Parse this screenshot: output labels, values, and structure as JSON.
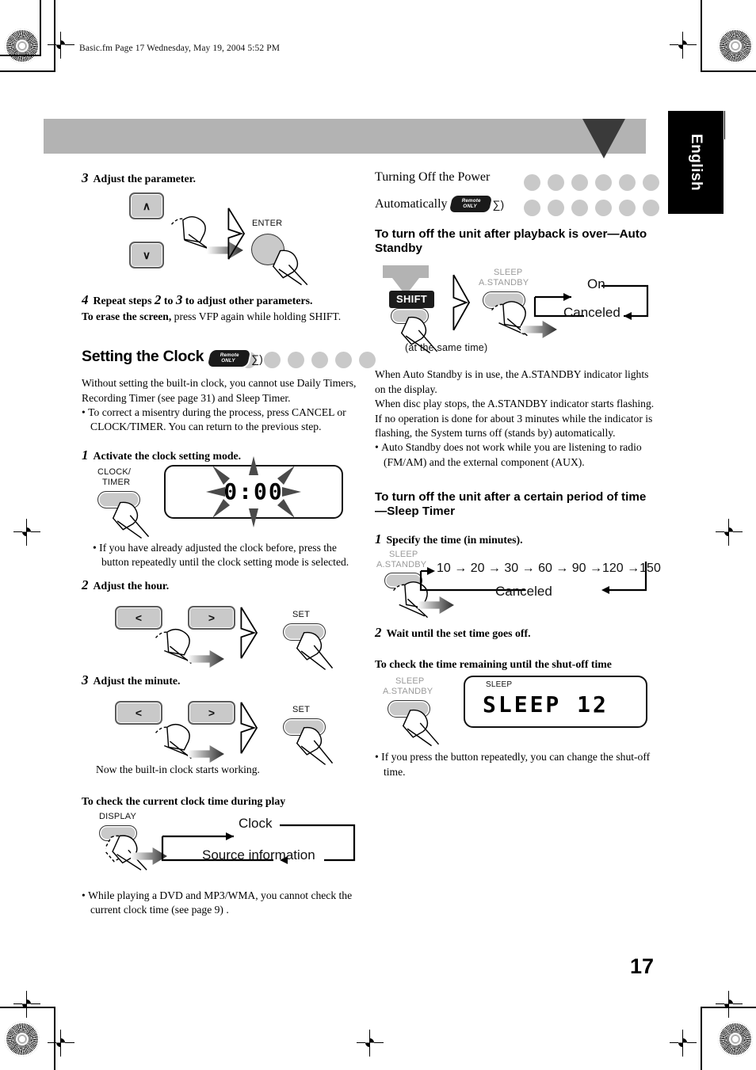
{
  "document": {
    "file_info": "Basic.fm  Page 17  Wednesday, May 19, 2004  5:52 PM",
    "language_tab": "English",
    "page_number": "17"
  },
  "left_column": {
    "step3": {
      "num": "3",
      "text": "Adjust the parameter.",
      "up_key": "∧",
      "down_key": "∨",
      "enter_label": "ENTER"
    },
    "step4": {
      "num": "4",
      "text_a": "Repeat steps ",
      "text_b": "2",
      "text_c": " to ",
      "text_d": "3",
      "text_e": " to adjust other parameters.",
      "erase_bold": "To erase the screen,",
      "erase_rest": " press VFP again while holding SHIFT."
    },
    "clock_section": {
      "title": "Setting the Clock",
      "badge_line1": "Remote",
      "badge_line2": "ONLY",
      "intro": "Without setting the built-in clock, you cannot use Daily Timers, Recording Timer (see page 31) and Sleep Timer.",
      "bullet": "To correct a misentry during the process, press CANCEL or CLOCK/TIMER. You can return to the previous step.",
      "step1": {
        "num": "1",
        "text": "Activate the clock setting mode.",
        "button_label_1": "CLOCK/",
        "button_label_2": "TIMER",
        "display_value": "0:00",
        "bullet": "If you have already adjusted the clock before, press the button repeatedly until the clock setting mode is selected."
      },
      "step2": {
        "num": "2",
        "text": "Adjust the hour.",
        "left_key": "<",
        "right_key": ">",
        "set_label": "SET"
      },
      "step3": {
        "num": "3",
        "text": "Adjust the minute.",
        "left_key": "<",
        "right_key": ">",
        "set_label": "SET"
      },
      "after_note": "Now the built-in clock starts working."
    },
    "check_clock": {
      "heading": "To check the current clock time during play",
      "button_label": "DISPLAY",
      "flow_top": "Clock",
      "flow_bottom": "Source information",
      "bullet": "While playing a DVD and MP3/WMA, you cannot check the current clock time (see page 9) ."
    }
  },
  "right_column": {
    "power_section": {
      "title_line1": "Turning Off the Power",
      "title_line2": "Automatically",
      "badge_line1": "Remote",
      "badge_line2": "ONLY"
    },
    "auto_standby": {
      "subhead": "To turn off the unit after playback is over—Auto Standby",
      "shift_key": "SHIFT",
      "sleep_label": "SLEEP",
      "standby_label": "A.STANDBY",
      "same_time_note": "(at the same time)",
      "flow_top": "On",
      "flow_bottom": "Canceled",
      "para1": "When Auto Standby is in use, the A.STANDBY indicator lights on the display.",
      "para2": "When disc play stops, the A.STANDBY indicator starts flashing. If no operation is done for about 3 minutes while the indicator is flashing, the System turns off (stands by) automatically.",
      "bullet": "Auto Standby does not work while you are listening to radio (FM/AM) and the external component (AUX)."
    },
    "sleep_timer": {
      "subhead": "To turn off the unit after a certain period of time —Sleep Timer",
      "step1": {
        "num": "1",
        "text": "Specify the time (in minutes).",
        "sleep_label": "SLEEP",
        "standby_label": "A.STANDBY",
        "sequence": [
          "10",
          "20",
          "30",
          "60",
          "90",
          "120",
          "150"
        ],
        "canceled": "Canceled"
      },
      "step2": {
        "num": "2",
        "text": "Wait until the set time goes off."
      },
      "check": {
        "heading": "To check the time remaining until the shut-off time",
        "sleep_label": "SLEEP",
        "standby_label": "A.STANDBY",
        "display_indicator": "SLEEP",
        "display_value": "SLEEP  12",
        "bullet": "If you press the button repeatedly, you can change the shut-off time."
      }
    }
  },
  "colors": {
    "banner_grey": "#b3b3b3",
    "dot_grey": "#c9c9c9",
    "tab_black": "#000000",
    "triangle_dark": "#3a3a3a"
  }
}
